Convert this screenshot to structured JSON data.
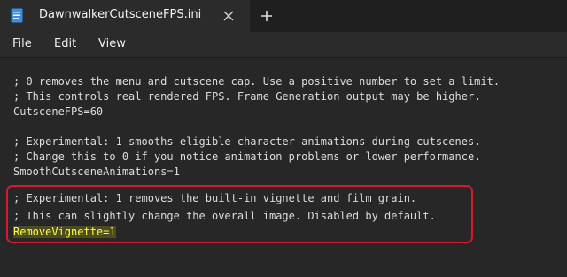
{
  "tab": {
    "title": "DawnwalkerCutsceneFPS.ini",
    "icons": {
      "file": "document-icon",
      "close": "close-icon",
      "new_tab": "plus-icon"
    }
  },
  "menu": {
    "items": [
      "File",
      "Edit",
      "View"
    ]
  },
  "editor": {
    "lines": [
      "; 0 removes the menu and cutscene cap. Use a positive number to set a limit.",
      "; This controls real rendered FPS. Frame Generation output may be higher.",
      "CutsceneFPS=60",
      "",
      "; Experimental: 1 smooths eligible character animations during cutscenes.",
      "; Change this to 0 if you notice animation problems or lower performance.",
      "SmoothCutsceneAnimations=1",
      "",
      "; Experimental: 1 removes the built-in vignette and film grain.",
      "; This can slightly change the overall image. Disabled by default.",
      "RemoveVignette=1"
    ],
    "selected_line_index": 10
  },
  "colors": {
    "background": "#272727",
    "annotation_box": "#d8182e",
    "selection_text": "#ffff40",
    "selection_bg": "#4c4c22"
  }
}
